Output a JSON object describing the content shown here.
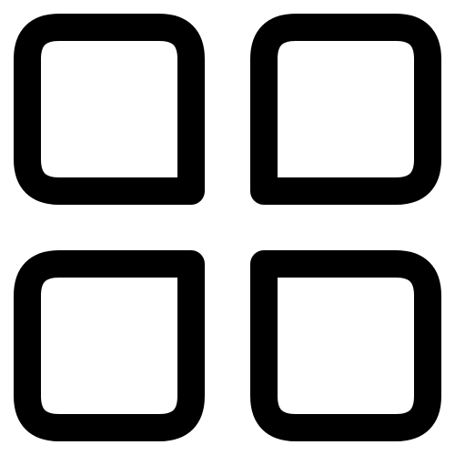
{
  "icon": {
    "name": "grid-view-icon",
    "stroke_color": "#000000",
    "background_color": "#ffffff"
  }
}
